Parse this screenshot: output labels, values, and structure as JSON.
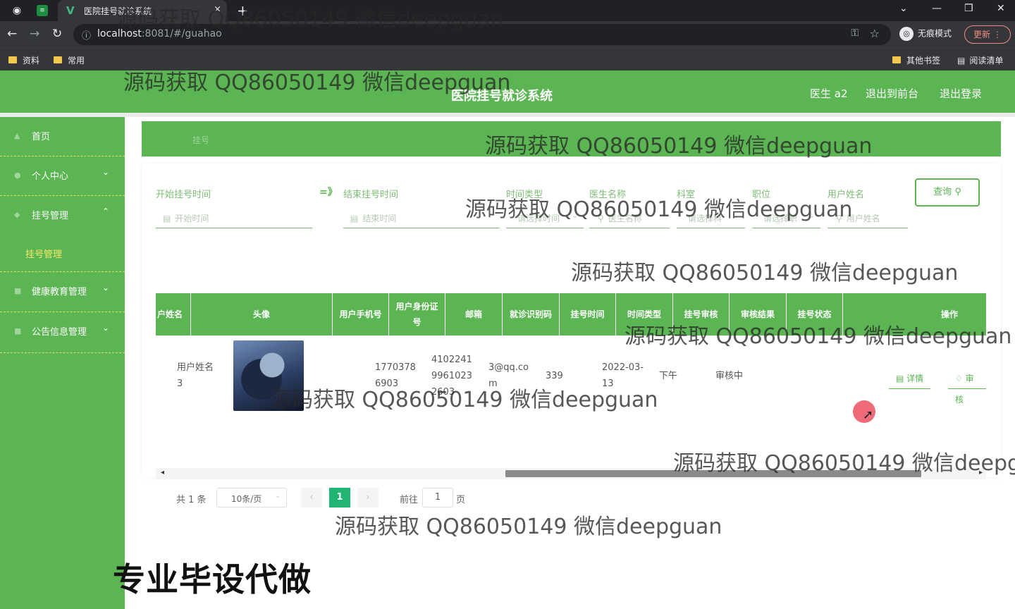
{
  "browser": {
    "tab_title": "医院挂号就诊系统",
    "tab_close": "×",
    "new_tab": "+",
    "url_host": "localhost",
    "url_path": ":8081/#/guahao",
    "incognito_label": "无痕模式",
    "update_label": "更新",
    "bookmarks": [
      "资料",
      "常用"
    ],
    "bookmarks_right": [
      "其他书签",
      "阅读清单"
    ]
  },
  "header": {
    "title": "医院挂号就诊系统",
    "user": "医生 a2",
    "exit_front": "退出到前台",
    "logout": "退出登录"
  },
  "sidebar": {
    "items": [
      {
        "label": "首页",
        "icon": "home-icon"
      },
      {
        "label": "个人中心",
        "icon": "user-icon",
        "arrow": "⌄"
      },
      {
        "label": "挂号管理",
        "icon": "register-icon",
        "arrow": "⌃"
      },
      {
        "label": "健康教育管理",
        "icon": "health-icon",
        "arrow": "⌄"
      },
      {
        "label": "公告信息管理",
        "icon": "notice-icon",
        "arrow": "⌄"
      }
    ],
    "sub_item": "挂号管理"
  },
  "breadcrumb": "挂号",
  "filters": {
    "start_label": "开始挂号时间",
    "start_placeholder": "开始时间",
    "range_sep": "=》",
    "end_label": "结束挂号时间",
    "end_placeholder": "结束时间",
    "time_type_label": "时间类型",
    "time_type_placeholder": "请选择时间",
    "doctor_label": "医生名称",
    "doctor_placeholder": "医生名称",
    "dept_label": "科室",
    "dept_placeholder": "请选择科",
    "position_label": "职位",
    "position_placeholder": "请选择职",
    "user_label": "用户姓名",
    "user_placeholder": "用户姓名",
    "query_button": "查询"
  },
  "table": {
    "headers": [
      "户姓名",
      "头像",
      "用户手机号",
      "用户身份证号",
      "邮箱",
      "就诊识别码",
      "挂号时间",
      "时间类型",
      "挂号审核",
      "审核结果",
      "挂号状态",
      "操作"
    ],
    "row": {
      "name": "用户姓名3",
      "phone": "17703786903",
      "id_card": "41022419961023 2603",
      "email": "3@qq.com",
      "code": "339",
      "time": "2022-03-13",
      "time_type": "下午",
      "review": "审核中",
      "result": "",
      "status": ""
    },
    "actions": {
      "detail": "详情",
      "audit": "审核"
    }
  },
  "pagination": {
    "total": "共 1 条",
    "page_size": "10条/页",
    "current_page": "1",
    "goto_label": "前往",
    "goto_value": "1",
    "page_unit": "页"
  },
  "watermark": "源码获取 QQ86050149 微信deepguan",
  "promo": "专业毕设代做"
}
